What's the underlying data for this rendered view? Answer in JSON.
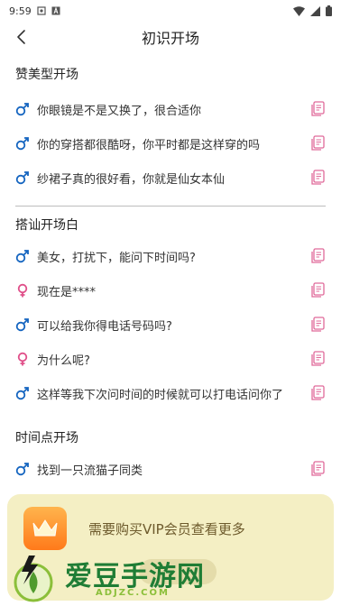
{
  "status": {
    "time": "9:59"
  },
  "header": {
    "title": "初识开场"
  },
  "sections": [
    {
      "title": "赞美型开场",
      "items": [
        {
          "gender": "male",
          "text": "你眼镜是不是又换了，很合适你"
        },
        {
          "gender": "male",
          "text": "你的穿搭都很酷呀，你平时都是这样穿的吗"
        },
        {
          "gender": "male",
          "text": "纱裙子真的很好看，你就是仙女本仙"
        }
      ]
    },
    {
      "title": "搭讪开场白",
      "items": [
        {
          "gender": "male",
          "text": "美女，打扰下，能问下时间吗?"
        },
        {
          "gender": "female",
          "text": "现在是****"
        },
        {
          "gender": "male",
          "text": "可以给我你得电话号码吗?"
        },
        {
          "gender": "female",
          "text": "为什么呢?"
        },
        {
          "gender": "male",
          "text": "这样等我下次问时间的时候就可以打电话问你了"
        }
      ]
    },
    {
      "title": "时间点开场",
      "items": [
        {
          "gender": "male",
          "text": "找到一只流猫子同类"
        }
      ]
    }
  ],
  "vip": {
    "text": "需要购买VIP会员查看更多"
  },
  "watermark": {
    "name": "爱豆手游网",
    "domain": "ADJZC.COM"
  },
  "colors": {
    "male": "#1565c0",
    "female": "#e0508a",
    "copy": "#e06a9a",
    "vip_bg": "#f4efc4"
  }
}
